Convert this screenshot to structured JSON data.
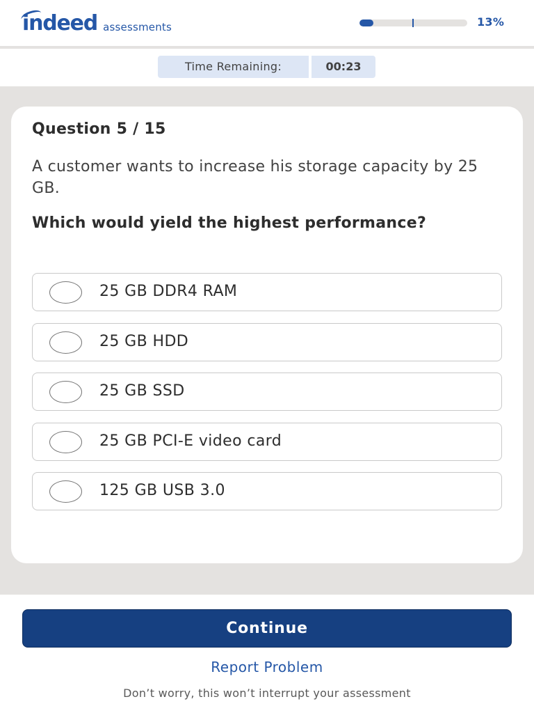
{
  "header": {
    "logo_text": "indeed",
    "logo_subtext": "assessments",
    "progress": {
      "percent": 13,
      "label": "13%"
    },
    "colors": {
      "brand": "#2557a7"
    }
  },
  "timer": {
    "label": "Time Remaining:",
    "value": "00:23"
  },
  "question": {
    "number_label": "Question 5 / 15",
    "text": "A customer wants to increase his storage capacity by 25 GB.",
    "prompt": "Which would yield the highest performance?",
    "options": [
      {
        "label": "25 GB DDR4 RAM",
        "selected": false
      },
      {
        "label": "25 GB HDD",
        "selected": false
      },
      {
        "label": "25 GB SSD",
        "selected": false
      },
      {
        "label": "25 GB PCI-E video card",
        "selected": false
      },
      {
        "label": "125 GB USB 3.0",
        "selected": false
      }
    ]
  },
  "footer": {
    "continue_label": "Continue",
    "report_label": "Report Problem",
    "reassure_text": "Don’t worry, this won’t interrupt your assessment",
    "colors": {
      "button": "#164081"
    }
  }
}
